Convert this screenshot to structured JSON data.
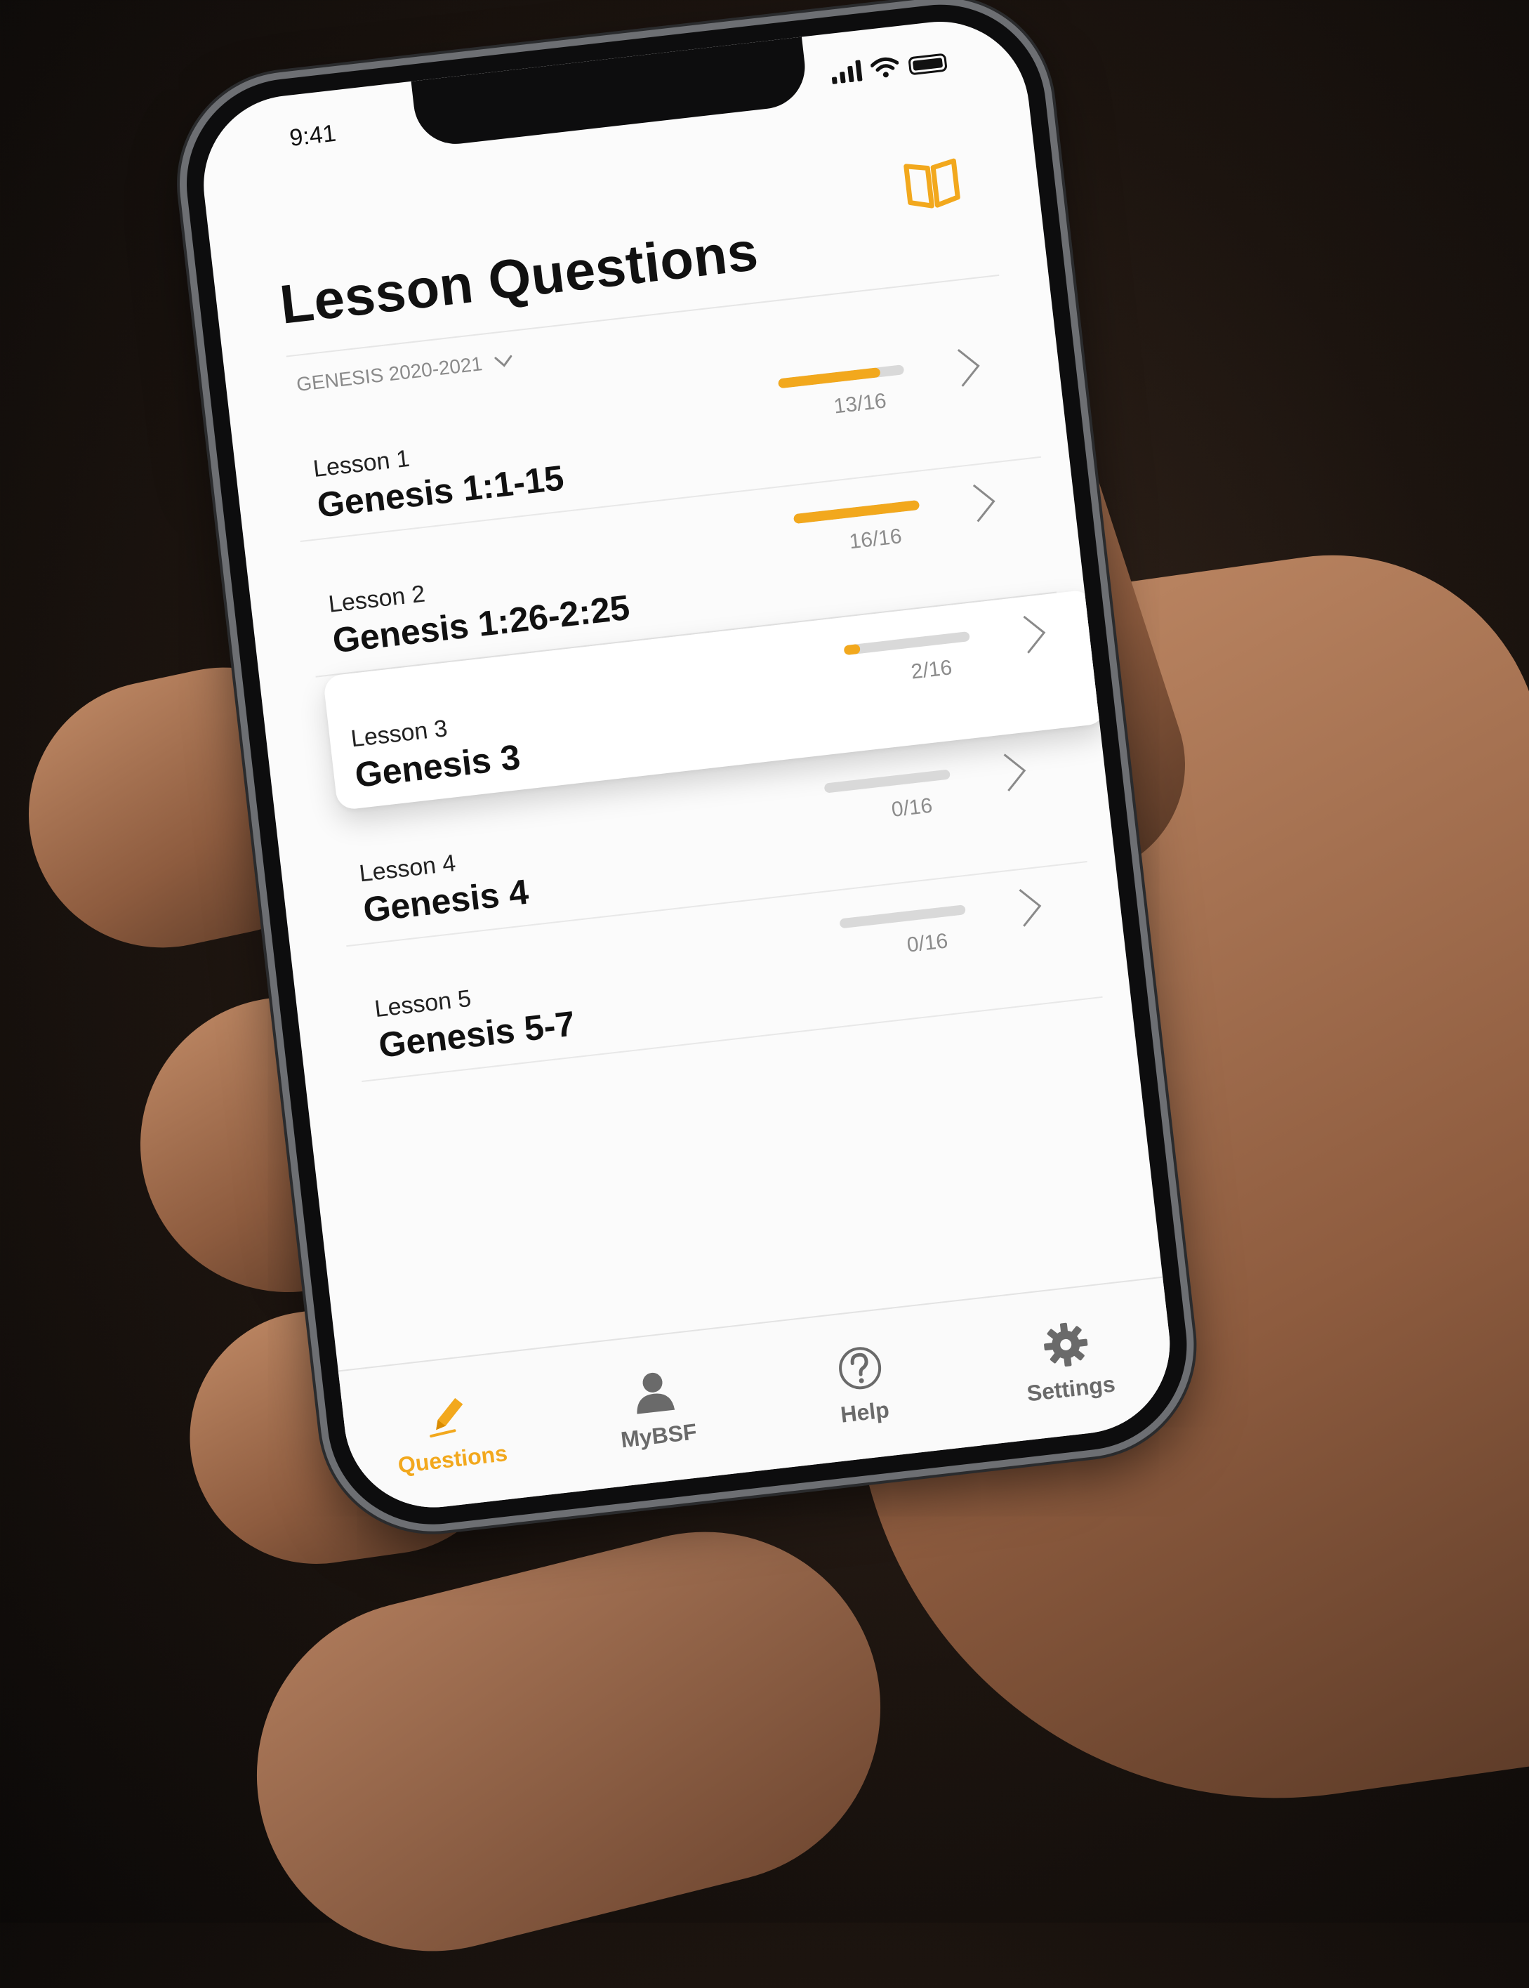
{
  "status_bar": {
    "time": "9:41"
  },
  "header": {
    "title": "Lesson Questions"
  },
  "study_selector": {
    "label": "GENESIS 2020-2021"
  },
  "lessons": [
    {
      "number": "Lesson 1",
      "passage": "Genesis 1:1-15",
      "count": "13/16",
      "progress": 0.8125
    },
    {
      "number": "Lesson 2",
      "passage": "Genesis 1:26-2:25",
      "count": "16/16",
      "progress": 1.0
    },
    {
      "number": "Lesson 3",
      "passage": "Genesis 3",
      "count": "2/16",
      "progress": 0.125
    },
    {
      "number": "Lesson 4",
      "passage": "Genesis 4",
      "count": "0/16",
      "progress": 0.0
    },
    {
      "number": "Lesson 5",
      "passage": "Genesis 5-7",
      "count": "0/16",
      "progress": 0.0
    }
  ],
  "tabs": [
    {
      "label": "Questions",
      "icon": "pencil-icon",
      "selected": true
    },
    {
      "label": "MyBSF",
      "icon": "person-icon",
      "selected": false
    },
    {
      "label": "Help",
      "icon": "question-circle-icon",
      "selected": false
    },
    {
      "label": "Settings",
      "icon": "gear-icon",
      "selected": false
    }
  ],
  "colors": {
    "accent": "#f2a81d",
    "track": "#d9d9d9",
    "background": "#fbfbfb"
  }
}
